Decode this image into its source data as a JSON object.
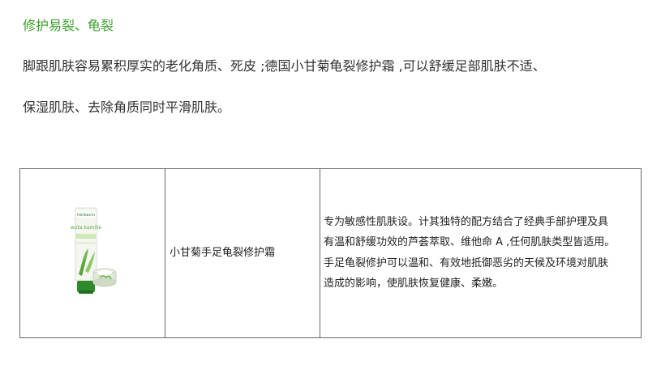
{
  "section": {
    "heading": "修护易裂、龟裂",
    "paragraph_lines": [
      "脚跟肌肤容易累积厚实的老化角质、死皮 ;德国小甘菊龟裂修护霜 ,可以舒缓足部肌肤不适、",
      "保湿肌肤、去除角质同时平滑肌肤。"
    ]
  },
  "product_table": {
    "image": {
      "brand_text": "herbacin",
      "tube_text": "wuta kamille"
    },
    "name": "小甘菊手足龟裂修护霜",
    "description_lines": [
      "专为敏感性肌肤设。计其独特的配方结合了经典手部护理及具",
      "有温和舒缓功效的芦荟萃取、维他命 A ,任何肌肤类型皆适用。",
      "手足龟裂修护可以温和、有效地抵御恶劣的天候及环境对肌肤",
      "造成的影响，使肌肤恢复健康、柔嫩。"
    ]
  },
  "colors": {
    "heading_green": "#3aa02a",
    "body_text": "#333333",
    "table_border": "#666666"
  }
}
